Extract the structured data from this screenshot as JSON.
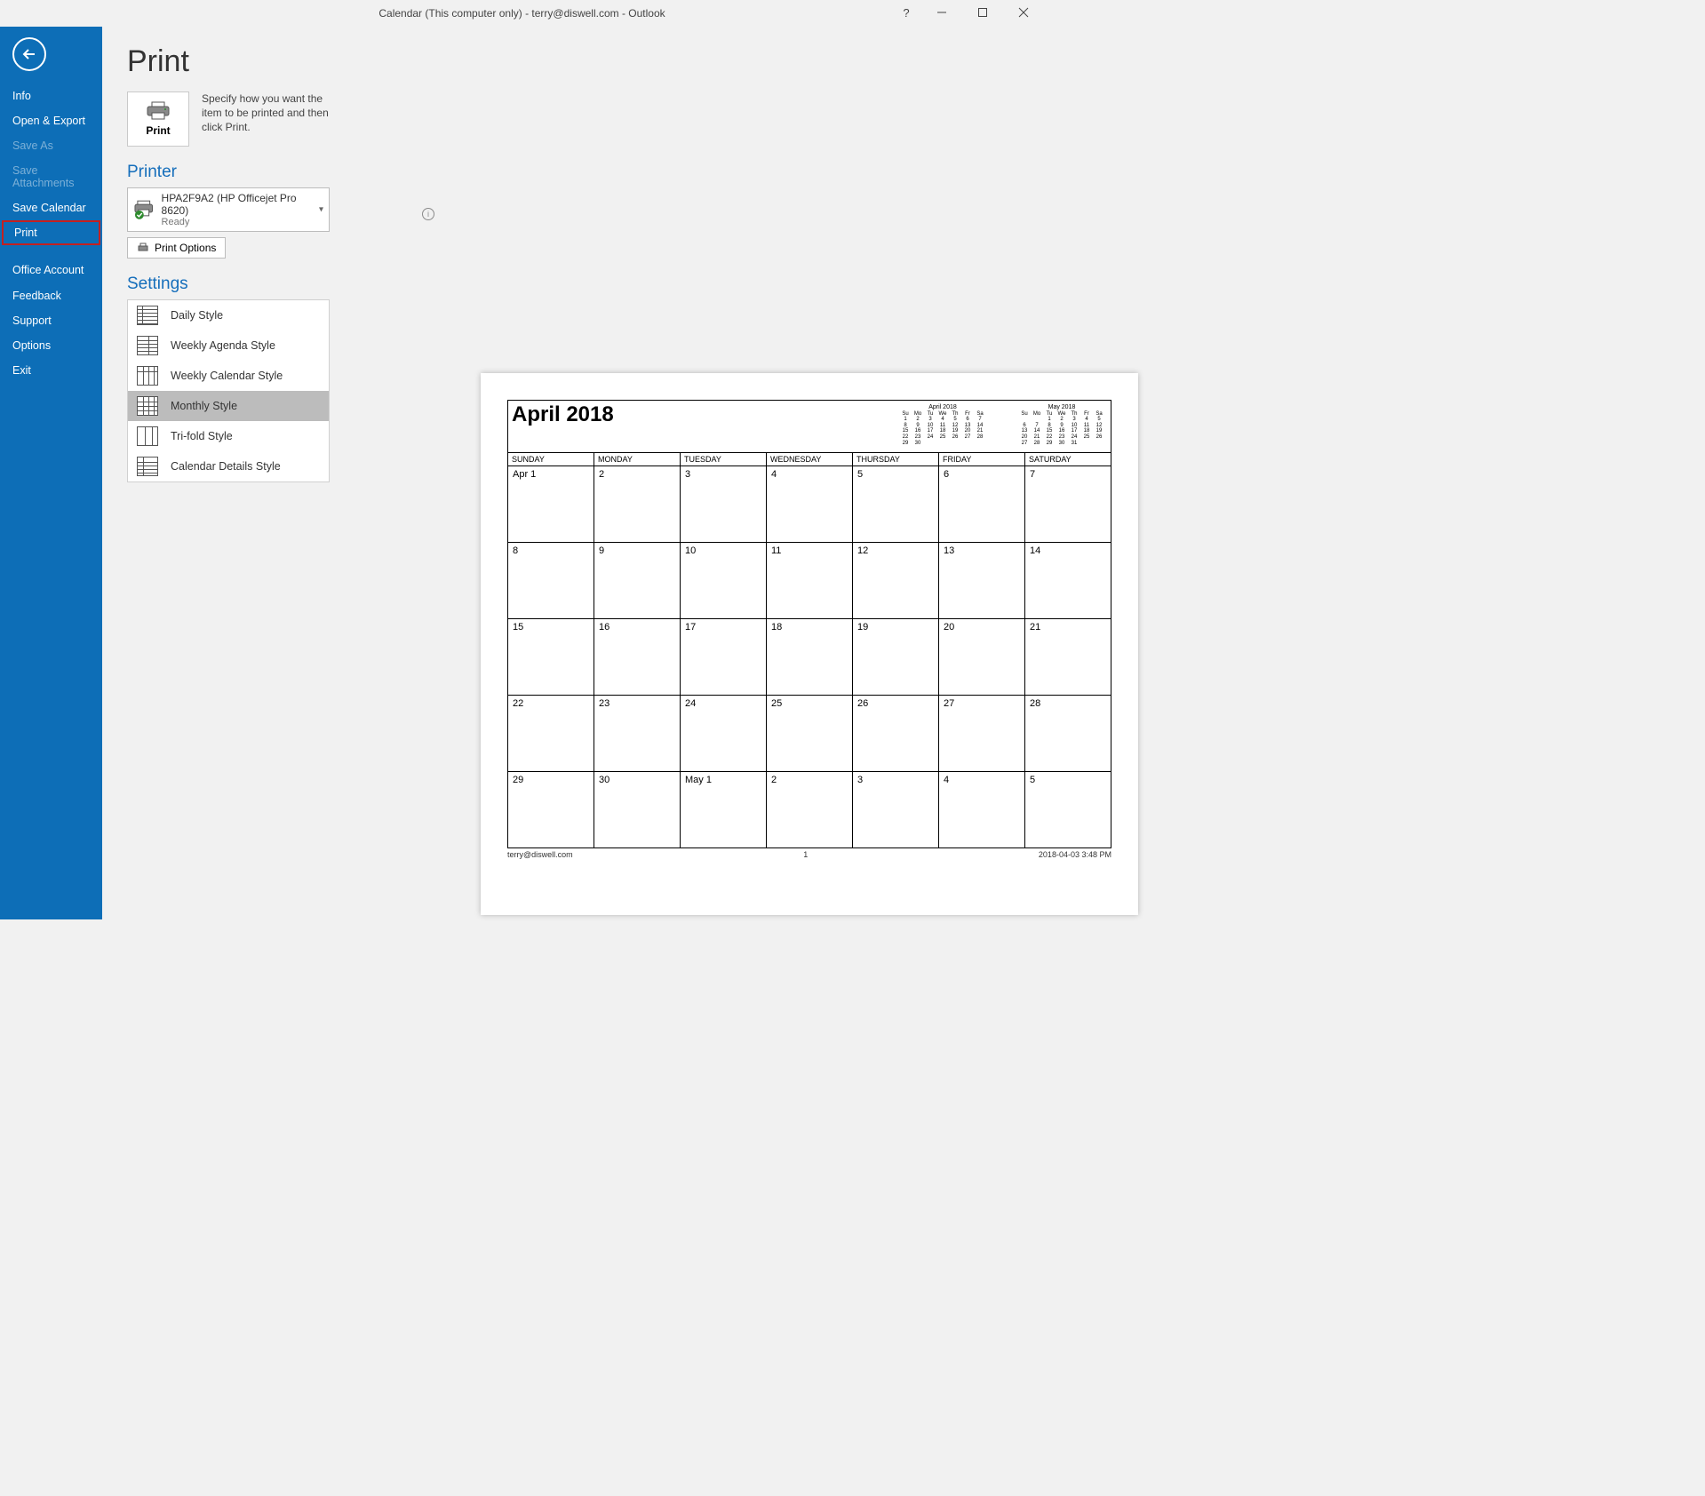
{
  "titlebar": {
    "title": "Calendar (This computer only) - terry@diswell.com  -  Outlook"
  },
  "sidebar": {
    "items": [
      {
        "label": "Info",
        "state": "normal"
      },
      {
        "label": "Open & Export",
        "state": "normal"
      },
      {
        "label": "Save As",
        "state": "disabled"
      },
      {
        "label": "Save Attachments",
        "state": "disabled"
      },
      {
        "label": "Save Calendar",
        "state": "normal"
      },
      {
        "label": "Print",
        "state": "highlighted"
      },
      {
        "label": "Office Account",
        "state": "normal"
      },
      {
        "label": "Feedback",
        "state": "normal"
      },
      {
        "label": "Support",
        "state": "normal"
      },
      {
        "label": "Options",
        "state": "normal"
      },
      {
        "label": "Exit",
        "state": "normal"
      }
    ]
  },
  "page": {
    "heading": "Print",
    "print_button_label": "Print",
    "help_text": "Specify how you want the item to be printed and then click Print."
  },
  "printer": {
    "section_label": "Printer",
    "name": "HPA2F9A2 (HP Officejet Pro 8620)",
    "status": "Ready",
    "options_label": "Print Options"
  },
  "settings": {
    "section_label": "Settings",
    "styles": [
      {
        "label": "Daily Style"
      },
      {
        "label": "Weekly Agenda Style"
      },
      {
        "label": "Weekly Calendar Style"
      },
      {
        "label": "Monthly Style",
        "selected": true
      },
      {
        "label": "Tri-fold Style"
      },
      {
        "label": "Calendar Details Style"
      }
    ]
  },
  "preview": {
    "title": "April 2018",
    "mini1": {
      "caption": "April 2018",
      "dow": [
        "Su",
        "Mo",
        "Tu",
        "We",
        "Th",
        "Fr",
        "Sa"
      ],
      "rows": [
        [
          "1",
          "2",
          "3",
          "4",
          "5",
          "6",
          "7"
        ],
        [
          "8",
          "9",
          "10",
          "11",
          "12",
          "13",
          "14"
        ],
        [
          "15",
          "16",
          "17",
          "18",
          "19",
          "20",
          "21"
        ],
        [
          "22",
          "23",
          "24",
          "25",
          "26",
          "27",
          "28"
        ],
        [
          "29",
          "30",
          "",
          "",
          "",
          "",
          ""
        ]
      ]
    },
    "mini2": {
      "caption": "May 2018",
      "dow": [
        "Su",
        "Mo",
        "Tu",
        "We",
        "Th",
        "Fr",
        "Sa"
      ],
      "rows": [
        [
          "",
          "",
          "1",
          "2",
          "3",
          "4",
          "5"
        ],
        [
          "6",
          "7",
          "8",
          "9",
          "10",
          "11",
          "12"
        ],
        [
          "13",
          "14",
          "15",
          "16",
          "17",
          "18",
          "19"
        ],
        [
          "20",
          "21",
          "22",
          "23",
          "24",
          "25",
          "26"
        ],
        [
          "27",
          "28",
          "29",
          "30",
          "31",
          "",
          ""
        ]
      ]
    },
    "dow": [
      "SUNDAY",
      "MONDAY",
      "TUESDAY",
      "WEDNESDAY",
      "THURSDAY",
      "FRIDAY",
      "SATURDAY"
    ],
    "cells": [
      [
        "Apr 1",
        "2",
        "3",
        "4",
        "5",
        "6",
        "7"
      ],
      [
        "8",
        "9",
        "10",
        "11",
        "12",
        "13",
        "14"
      ],
      [
        "15",
        "16",
        "17",
        "18",
        "19",
        "20",
        "21"
      ],
      [
        "22",
        "23",
        "24",
        "25",
        "26",
        "27",
        "28"
      ],
      [
        "29",
        "30",
        "May 1",
        "2",
        "3",
        "4",
        "5"
      ]
    ],
    "footer_left": "terry@diswell.com",
    "footer_center": "1",
    "footer_right": "2018-04-03 3:48 PM"
  }
}
